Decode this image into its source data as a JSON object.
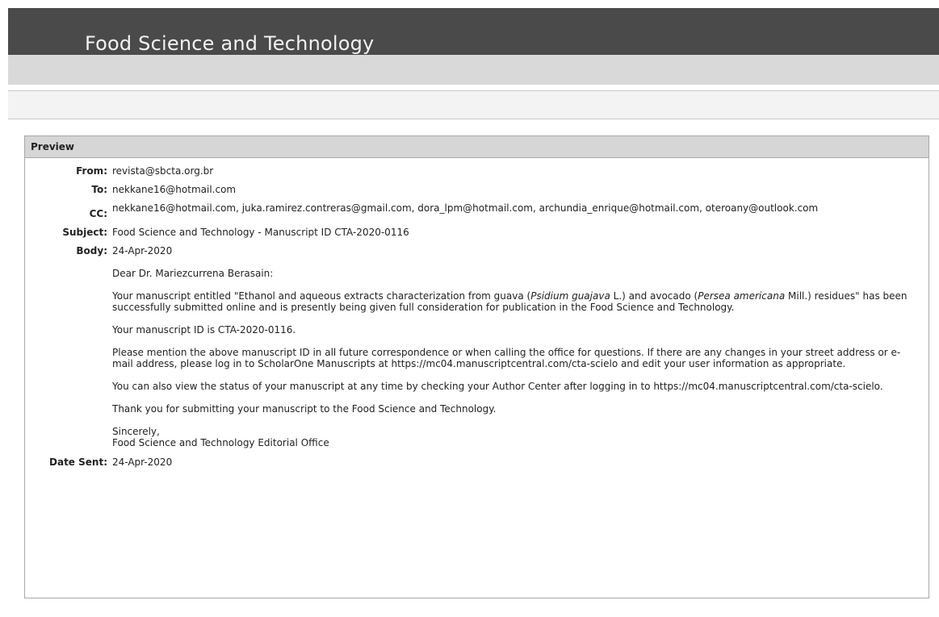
{
  "app": {
    "title": "Food Science and Technology"
  },
  "preview": {
    "heading": "Preview",
    "from_label": "From:",
    "from": "revista@sbcta.org.br",
    "to_label": "To:",
    "to": "nekkane16@hotmail.com",
    "cc_label": "CC:",
    "cc": "nekkane16@hotmail.com, juka.ramirez.contreras@gmail.com, dora_lpm@hotmail.com, archundia_enrique@hotmail.com, oteroany@outlook.com",
    "subject_label": "Subject:",
    "subject": "Food Science and Technology - Manuscript ID CTA-2020-0116",
    "body_label": "Body:",
    "body": {
      "date": "24-Apr-2020",
      "greeting": "Dear Dr. Mariezcurrena Berasain:",
      "p1_a": "Your manuscript entitled \"Ethanol and aqueous extracts characterization from guava (",
      "p1_italic1": "Psidium guajava",
      "p1_b": " L.) and avocado (",
      "p1_italic2": "Persea americana",
      "p1_c": " Mill.) residues\" has been successfully submitted online and is presently being given full consideration for publication in the Food Science and Technology.",
      "p2": "Your manuscript ID is CTA-2020-0116.",
      "p3": "Please mention the above manuscript ID in all future correspondence or when calling the office for questions. If there are any changes in your street address or e-mail address, please log in to ScholarOne Manuscripts at https://mc04.manuscriptcentral.com/cta-scielo and edit your user information as appropriate.",
      "p4": "You can also view the status of your manuscript at any time by checking your Author Center after logging in to https://mc04.manuscriptcentral.com/cta-scielo.",
      "p5": "Thank you for submitting your manuscript to the Food Science and Technology.",
      "closing": "Sincerely,",
      "signature": "Food Science and Technology Editorial Office"
    },
    "date_sent_label": "Date Sent:",
    "date_sent": "24-Apr-2020"
  }
}
